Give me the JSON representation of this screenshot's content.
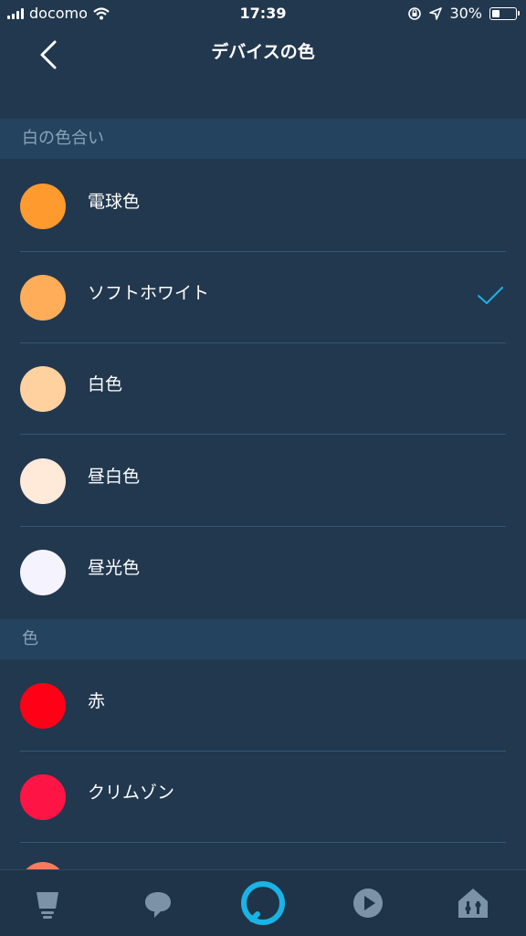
{
  "status": {
    "carrier": "docomo",
    "time": "17:39",
    "battery": "30%",
    "battery_level": 0.3
  },
  "nav": {
    "title": "デバイスの色",
    "back_icon": "chevron-left-icon"
  },
  "sections": {
    "white": {
      "title": "白の色合い",
      "items": [
        {
          "label": "電球色",
          "color": "#ff9a2e"
        },
        {
          "label": "ソフトホワイト",
          "color": "#ffad58",
          "selected": true
        },
        {
          "label": "白色",
          "color": "#ffd19e"
        },
        {
          "label": "昼白色",
          "color": "#ffe9d9"
        },
        {
          "label": "昼光色",
          "color": "#f5f3fd"
        }
      ]
    },
    "colors": {
      "title": "色",
      "items": [
        {
          "label": "赤",
          "color": "#ff0016"
        },
        {
          "label": "クリムゾン",
          "color": "#ff1545"
        }
      ]
    }
  },
  "accent_color": "#1ab3e6",
  "tabs": [
    {
      "icon": "device-lamp-icon",
      "active": false
    },
    {
      "icon": "communicate-icon",
      "active": false
    },
    {
      "icon": "alexa-icon",
      "active": true
    },
    {
      "icon": "play-icon",
      "active": false
    },
    {
      "icon": "smart-home-icon",
      "active": false
    }
  ]
}
